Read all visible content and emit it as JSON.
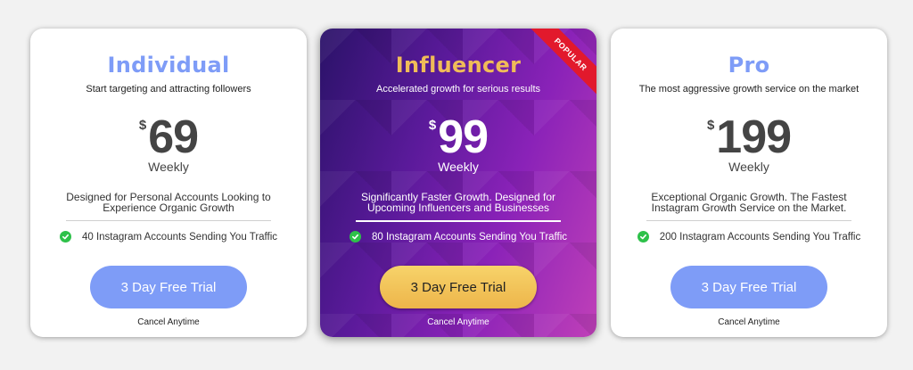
{
  "colors": {
    "individual_title": "#7e9cf7",
    "influencer_title": "#f0bc58",
    "pro_title": "#7e9cf7",
    "check": "#2ec14a",
    "ribbon": "#e2192c"
  },
  "icons": {
    "feature": "check-circle-icon"
  },
  "plans": [
    {
      "title": "Individual",
      "subtitle": "Start targeting and attracting followers",
      "currency": "$",
      "price": "69",
      "period": "Weekly",
      "description": "Designed for Personal Accounts Looking to Experience Organic Growth",
      "feature": "40 Instagram Accounts Sending You Traffic",
      "cta": "3 Day Free Trial",
      "cancel": "Cancel Anytime"
    },
    {
      "title": "Influencer",
      "subtitle": "Accelerated growth for serious results",
      "currency": "$",
      "price": "99",
      "period": "Weekly",
      "description": "Significantly Faster Growth. Designed for Upcoming Influencers and Businesses",
      "feature": "80 Instagram Accounts Sending You Traffic",
      "cta": "3 Day Free Trial",
      "cancel": "Cancel Anytime",
      "badge": "POPULAR"
    },
    {
      "title": "Pro",
      "subtitle": "The most aggressive growth service on the market",
      "currency": "$",
      "price": "199",
      "period": "Weekly",
      "description": "Exceptional Organic Growth. The Fastest Instagram Growth Service on the Market.",
      "feature": "200 Instagram Accounts Sending You Traffic",
      "cta": "3 Day Free Trial",
      "cancel": "Cancel Anytime"
    }
  ]
}
